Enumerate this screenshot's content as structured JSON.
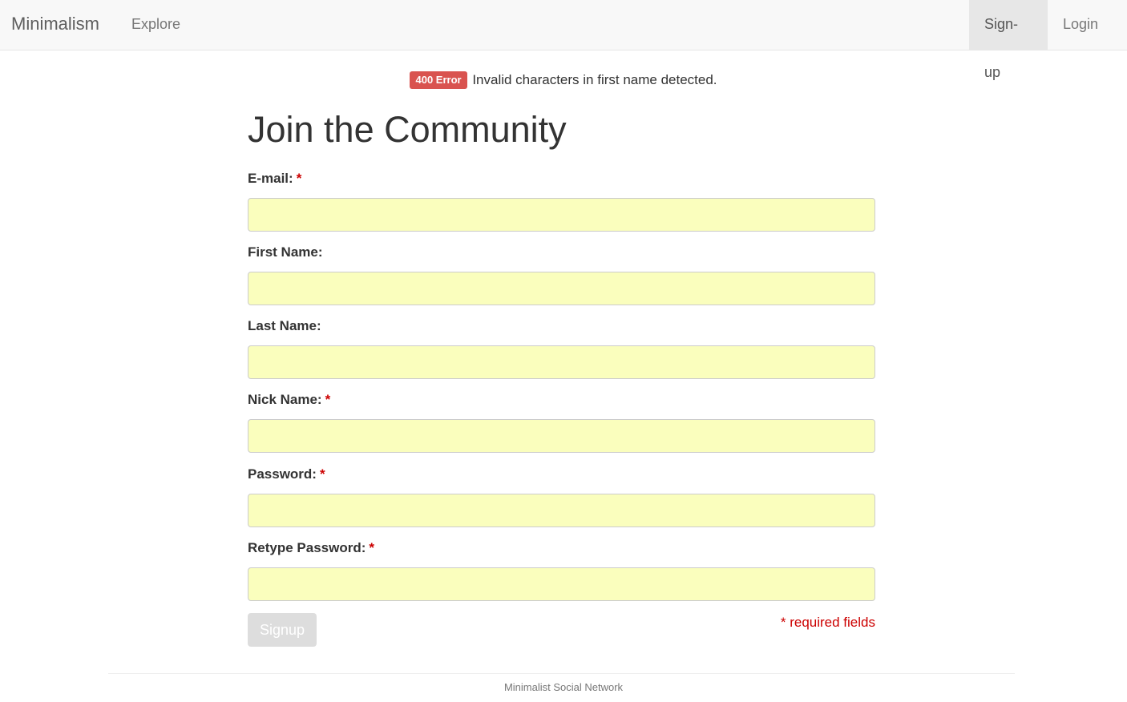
{
  "navbar": {
    "brand": "Minimalism",
    "explore": "Explore",
    "signup": "Sign-up",
    "login": "Login"
  },
  "alert": {
    "badge": "400 Error",
    "message": "Invalid characters in first name detected."
  },
  "form": {
    "title": "Join the Community",
    "required_marker": "*",
    "fields": [
      {
        "label": "E-mail:",
        "required": true,
        "value": ""
      },
      {
        "label": "First Name:",
        "required": false,
        "value": ""
      },
      {
        "label": "Last Name:",
        "required": false,
        "value": ""
      },
      {
        "label": "Nick Name:",
        "required": true,
        "value": ""
      },
      {
        "label": "Password:",
        "required": true,
        "value": ""
      },
      {
        "label": "Retype Password:",
        "required": true,
        "value": ""
      }
    ],
    "submit_label": "Signup",
    "required_note": "* required fields"
  },
  "footer": {
    "text": "Minimalist Social Network"
  },
  "colors": {
    "input_bg": "#fafebd",
    "error_badge": "#d9534f",
    "required": "#cc0000"
  }
}
